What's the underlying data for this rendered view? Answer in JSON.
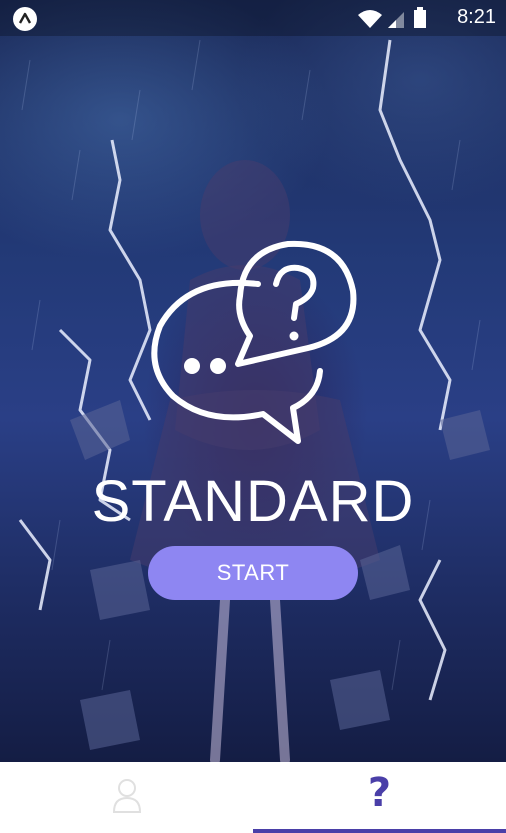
{
  "status_bar": {
    "time": "8:21",
    "app_icon": "a-logo-icon",
    "icons": [
      "wifi-icon",
      "cellular-signal-icon",
      "battery-icon"
    ]
  },
  "main": {
    "mode_title": "STANDARD",
    "start_label": "START",
    "hero_icon": "chat-question-icon",
    "accent_color": "#8e86f2"
  },
  "tab_bar": {
    "tabs": [
      {
        "icon": "user-icon",
        "active": false
      },
      {
        "icon": "question-icon",
        "glyph": "?",
        "active": true
      }
    ],
    "active_color": "#4a3fa8"
  }
}
